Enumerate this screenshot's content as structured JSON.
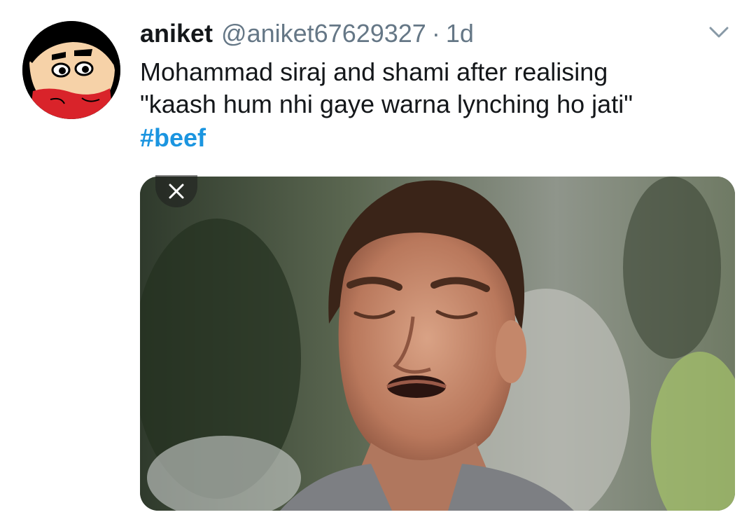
{
  "tweet": {
    "author_name": "aniket",
    "author_handle": "@aniket67629327",
    "separator": "·",
    "timestamp": "1d",
    "text": "Mohammad siraj and shami after realising\n\"kaash hum nhi gaye warna lynching ho jati\"",
    "hashtag": "#beef"
  },
  "colors": {
    "link": "#1b95e0",
    "muted": "#657786",
    "text": "#14171a"
  },
  "icons": {
    "menu": "chevron-down-icon",
    "close": "close-icon",
    "avatar": "cartoon-avatar"
  }
}
